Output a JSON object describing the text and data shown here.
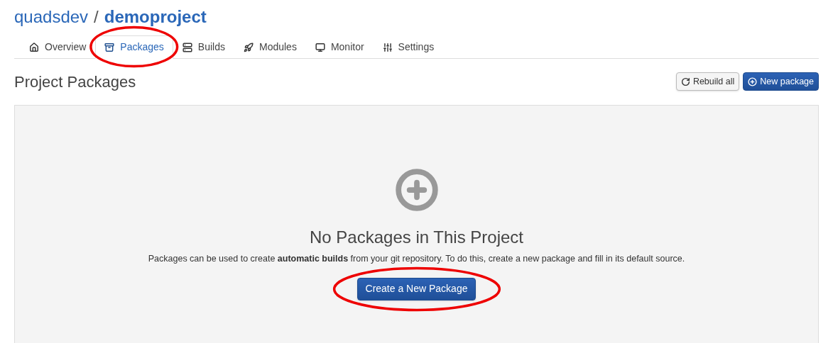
{
  "breadcrumb": {
    "owner": "quadsdev",
    "separator": "/",
    "project": "demoproject"
  },
  "tabs": [
    {
      "kind": "home",
      "label": "Overview",
      "selected": false,
      "circled": false
    },
    {
      "kind": "archive",
      "label": "Packages",
      "selected": true,
      "circled": true
    },
    {
      "kind": "list",
      "label": "Builds",
      "selected": false,
      "circled": false
    },
    {
      "kind": "rocket",
      "label": "Modules",
      "selected": false,
      "circled": false
    },
    {
      "kind": "monitor",
      "label": "Monitor",
      "selected": false,
      "circled": false
    },
    {
      "kind": "sliders",
      "label": "Settings",
      "selected": false,
      "circled": false
    }
  ],
  "section_title": "Project Packages",
  "header_buttons": [
    {
      "kind": "default",
      "label": "Rebuild all"
    },
    {
      "kind": "primary",
      "label": "New package"
    }
  ],
  "empty_state": {
    "heading": "No Packages in This Project",
    "text": "Packages can be used to create **automatic builds** from your git repository. To do this, create a new package and fill in its default source.",
    "button": {
      "label": "Create a New Package",
      "circled": true
    }
  }
}
